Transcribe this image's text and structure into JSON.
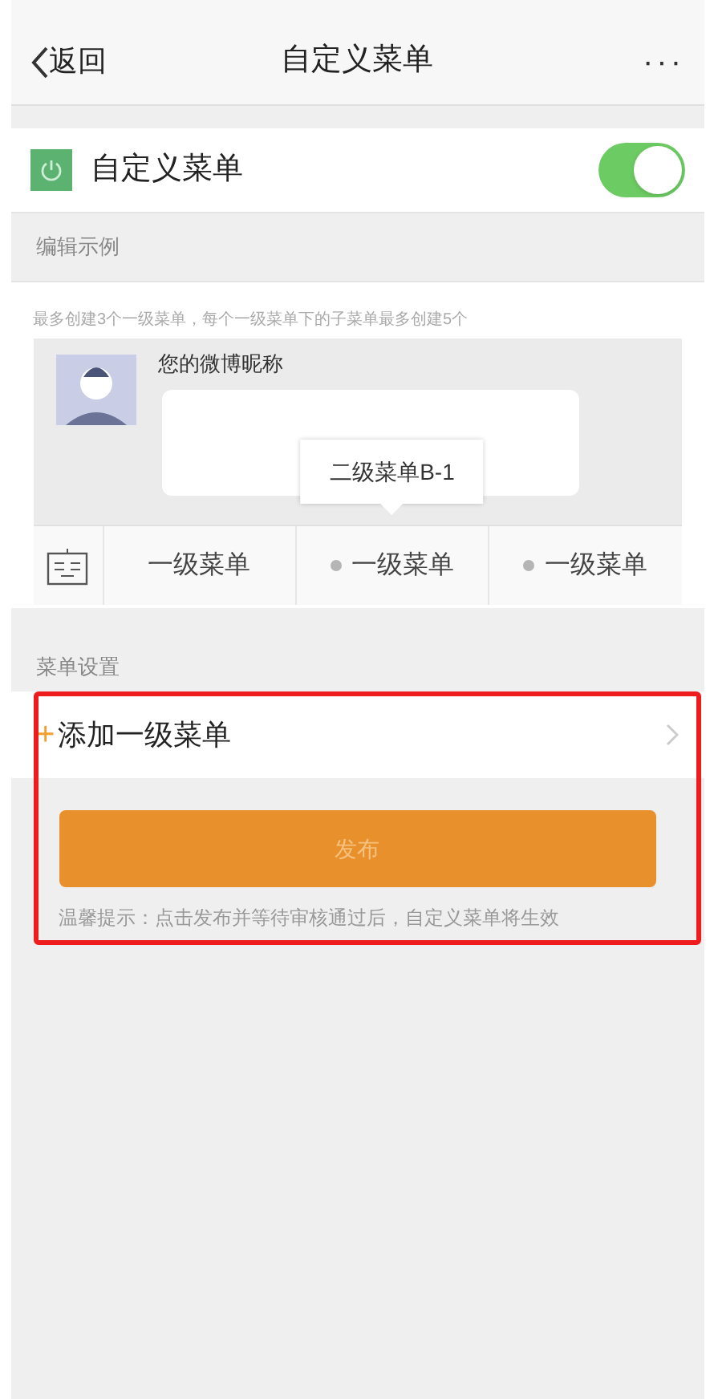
{
  "nav": {
    "back": "返回",
    "title": "自定义菜单",
    "more": "···"
  },
  "toggle": {
    "label": "自定义菜单",
    "on": true
  },
  "example": {
    "header": "编辑示例",
    "hint": "最多创建3个一级菜单，每个一级菜单下的子菜单最多创建5个",
    "nickname": "您的微博昵称",
    "menus": [
      {
        "label": "一级菜单",
        "has_submenu": false
      },
      {
        "label": "一级菜单",
        "has_submenu": true,
        "submenu": [
          "二级菜单B-1"
        ]
      },
      {
        "label": "一级菜单",
        "has_submenu": true
      }
    ]
  },
  "settings": {
    "header": "菜单设置",
    "add_icon": "+",
    "add": "添加一级菜单",
    "publish": "发布",
    "tip": "温馨提示：点击发布并等待审核通过后，自定义菜单将生效",
    "highlighted": true
  }
}
